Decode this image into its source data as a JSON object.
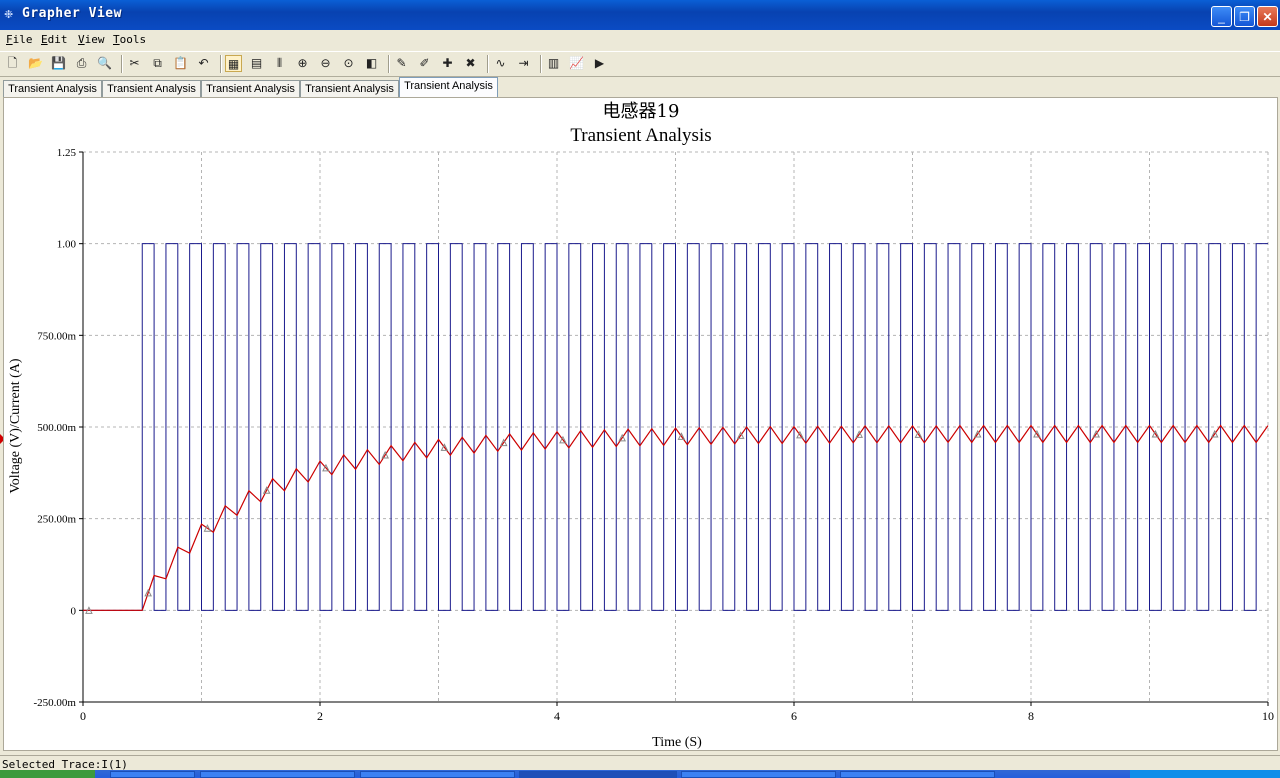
{
  "window": {
    "title": "Grapher View",
    "app_icon": "grapher-icon",
    "buttons": {
      "minimize": "minimize-icon",
      "maximize": "restore-icon",
      "close": "close-icon"
    }
  },
  "menu": [
    {
      "first": "F",
      "rest": "ile"
    },
    {
      "first": "E",
      "rest": "dit"
    },
    {
      "first": "V",
      "rest": "iew"
    },
    {
      "first": "T",
      "rest": "ools"
    }
  ],
  "toolbar": [
    "new-icon",
    "open-icon",
    "save-icon",
    "print-icon",
    "print-preview-icon",
    "sep",
    "cut-icon",
    "copy-icon",
    "paste-icon",
    "undo-icon",
    "sep",
    "grid-icon",
    "legend-icon",
    "cursors-icon",
    "zoom-in-icon",
    "zoom-out-icon",
    "zoom-full-icon",
    "reverse-colors-icon",
    "sep",
    "select-trace-icon",
    "trace-properties-icon",
    "add-trace-icon",
    "remove-trace-icon",
    "sep",
    "overlay-traces-icon",
    "export-icon",
    "sep",
    "show-data-icon",
    "export-chart-icon",
    "run-icon"
  ],
  "tabs": [
    "Transient Analysis",
    "Transient Analysis",
    "Transient Analysis",
    "Transient Analysis",
    "Transient Analysis"
  ],
  "active_tab": 4,
  "status": {
    "selected_trace": "Selected Trace:I(1)"
  },
  "colors": {
    "square_wave": "#1a1a8c",
    "current_trace": "#cc0000",
    "marker": "#888888",
    "grid": "#b4b4b4"
  },
  "chart_data": {
    "type": "line",
    "title": "电感器19",
    "subtitle": "Transient Analysis",
    "xlabel": "Time (S)",
    "ylabel": "Voltage (V)/Current (A)",
    "xlim": [
      0,
      10
    ],
    "ylim": [
      -0.25,
      1.25
    ],
    "x_ticks": [
      0,
      2,
      4,
      6,
      8,
      10
    ],
    "x_tick_labels": [
      "0",
      "2",
      "4",
      "6",
      "8",
      "10"
    ],
    "y_ticks": [
      -0.25,
      0,
      0.25,
      0.5,
      0.75,
      1.0,
      1.25
    ],
    "y_tick_labels": [
      "-250.00m",
      "0",
      "250.00m",
      "500.00m",
      "750.00m",
      "1.00",
      "1.25"
    ],
    "grid": true,
    "series": [
      {
        "kind": "square-wave",
        "start": 0.5,
        "period": 0.2,
        "duty": 0.5,
        "low": 0,
        "high": 1,
        "x_end": 10
      },
      {
        "kind": "rl-charging",
        "x": [
          0,
          0.5,
          0.6,
          0.7,
          0.8,
          0.9,
          1.0,
          1.1,
          1.2,
          1.3,
          1.4,
          1.5,
          1.6,
          1.7,
          1.8,
          1.9,
          2.0,
          2.1,
          2.2,
          2.3,
          2.4,
          2.5,
          2.6,
          2.7,
          2.8,
          2.9,
          3.0,
          3.1,
          3.2,
          3.3,
          3.4,
          3.5,
          3.6,
          3.7,
          3.8,
          3.9,
          4.0,
          4.1,
          4.2,
          4.3,
          4.4,
          4.5,
          4.6,
          4.7,
          4.8,
          4.9,
          5.0,
          5.1,
          5.2,
          5.3,
          5.4,
          5.5,
          5.6,
          5.7,
          5.8,
          5.9,
          6.0,
          6.1,
          6.2,
          6.3,
          6.4,
          6.5,
          6.6,
          6.7,
          6.8,
          6.9,
          7.0,
          7.1,
          7.2,
          7.3,
          7.4,
          7.5,
          7.6,
          7.7,
          7.8,
          7.9,
          8.0,
          8.1,
          8.2,
          8.3,
          8.4,
          8.5,
          8.6,
          8.7,
          8.8,
          8.9,
          9.0,
          9.1,
          9.2,
          9.3,
          9.4,
          9.5,
          9.6,
          9.7,
          9.8,
          9.9,
          10.0
        ],
        "y": [
          0,
          0,
          0.095,
          0.086,
          0.172,
          0.156,
          0.235,
          0.213,
          0.285,
          0.259,
          0.326,
          0.296,
          0.359,
          0.326,
          0.386,
          0.35,
          0.407,
          0.37,
          0.424,
          0.385,
          0.438,
          0.398,
          0.449,
          0.408,
          0.458,
          0.416,
          0.466,
          0.423,
          0.472,
          0.429,
          0.477,
          0.434,
          0.481,
          0.437,
          0.484,
          0.44,
          0.487,
          0.443,
          0.49,
          0.445,
          0.492,
          0.447,
          0.494,
          0.449,
          0.495,
          0.45,
          0.497,
          0.452,
          0.498,
          0.453,
          0.499,
          0.454,
          0.5,
          0.455,
          0.501,
          0.455,
          0.501,
          0.456,
          0.502,
          0.456,
          0.502,
          0.457,
          0.503,
          0.457,
          0.503,
          0.457,
          0.503,
          0.457,
          0.503,
          0.458,
          0.504,
          0.458,
          0.504,
          0.458,
          0.504,
          0.458,
          0.504,
          0.458,
          0.504,
          0.458,
          0.504,
          0.458,
          0.504,
          0.458,
          0.504,
          0.458,
          0.504,
          0.458,
          0.504,
          0.458,
          0.504,
          0.458,
          0.504,
          0.458,
          0.504,
          0.458,
          0.504
        ]
      }
    ],
    "marker_x": [
      0.05,
      0.55,
      1.05,
      1.55,
      2.05,
      2.55,
      3.05,
      3.55,
      4.05,
      4.55,
      5.05,
      5.55,
      6.05,
      6.55,
      7.05,
      7.55,
      8.05,
      8.55,
      9.05,
      9.55
    ]
  }
}
